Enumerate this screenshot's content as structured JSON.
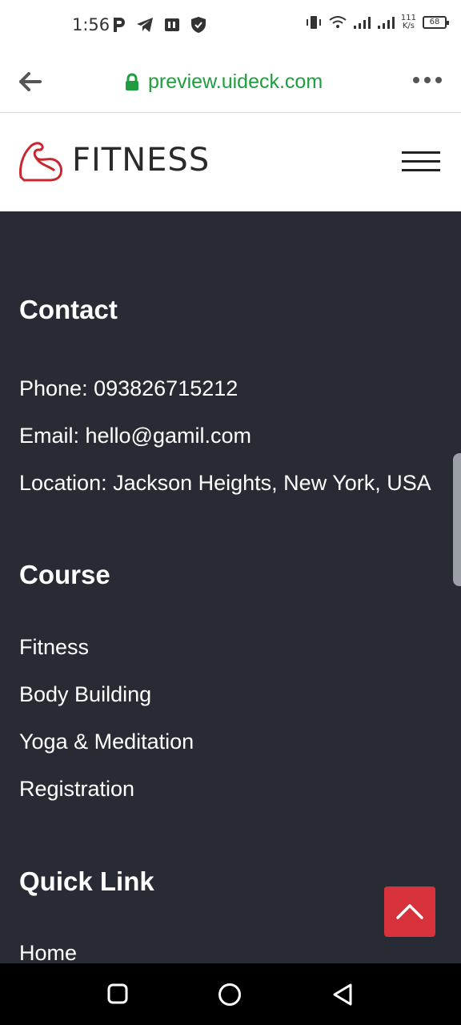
{
  "status_bar": {
    "time": "1:56",
    "net_speed_value": "111",
    "net_speed_unit": "K/s",
    "battery": "68"
  },
  "browser": {
    "url": "preview.uideck.com"
  },
  "site": {
    "logo_text": "FITNESS"
  },
  "contact": {
    "title": "Contact",
    "phone": "Phone: 093826715212",
    "email": "Email: hello@gamil.com",
    "location": "Location: Jackson Heights, New York, USA"
  },
  "course": {
    "title": "Course",
    "items": [
      "Fitness",
      "Body Building",
      "Yoga & Meditation",
      "Registration"
    ]
  },
  "quick_link": {
    "title": "Quick Link",
    "items": [
      "Home"
    ]
  },
  "colors": {
    "footer_bg": "#282b33",
    "accent": "#d7323c",
    "url_green": "#1e9e3e"
  }
}
